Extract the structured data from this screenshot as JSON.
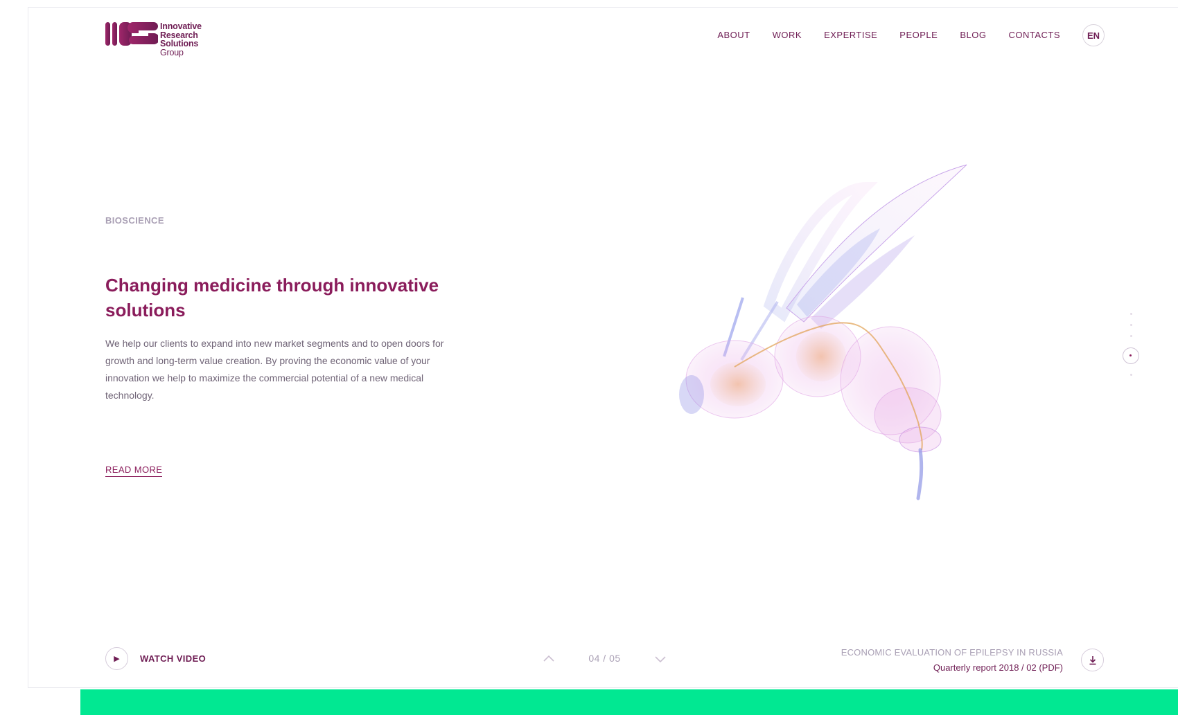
{
  "brand": {
    "logo_lines": [
      "Innovative",
      "Research",
      "Solutions",
      "Group"
    ],
    "primary_color": "#8a1c5b",
    "accent_color": "#01e892"
  },
  "nav": {
    "items": [
      "ABOUT",
      "WORK",
      "EXPERTISE",
      "PEOPLE",
      "BLOG",
      "CONTACTS"
    ],
    "language": "EN"
  },
  "hero": {
    "category": "BIOSCIENCE",
    "title": "Changing medicine through innovative solutions",
    "description": "We help our clients to expand into new market segments and to open doors for growth and long-term value creation. By proving the economic value of your innovation we help to maximize the commercial potential of a new medical technology.",
    "read_more": "READ MORE"
  },
  "footer": {
    "watch_video": "WATCH VIDEO",
    "pager": "04 / 05",
    "report_title": "ECONOMIC EVALUATION OF EPILEPSY IN RUSSIA",
    "report_subtitle": "Quarterly report 2018 / 02 (PDF)"
  },
  "icons": {
    "play": "play-icon",
    "up": "chevron-up-icon",
    "down": "chevron-down-icon",
    "download": "download-icon",
    "illustration": "bee-illustration"
  }
}
